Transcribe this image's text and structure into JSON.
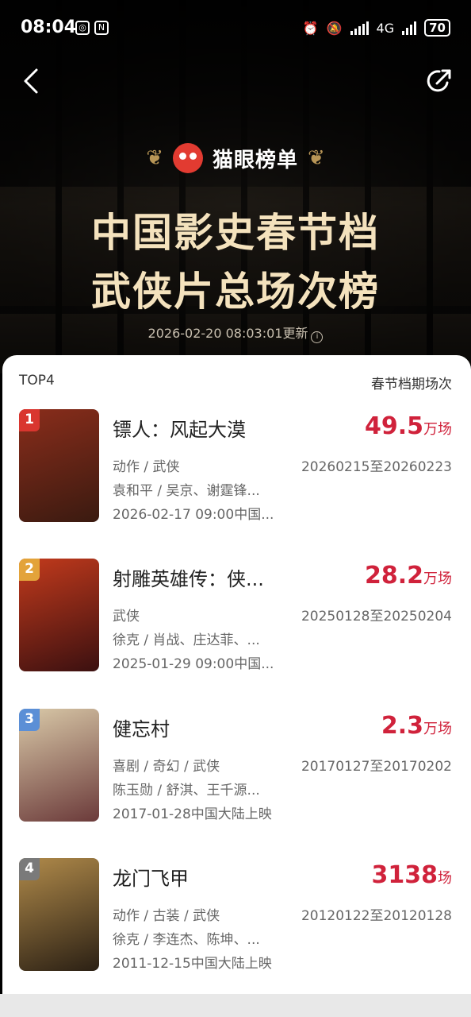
{
  "status_bar": {
    "time": "08:04",
    "network": "4G",
    "battery": "70"
  },
  "header": {
    "brand": "猫眼榜单",
    "title_line1": "中国影史春节档",
    "title_line2": "武侠片总场次榜",
    "update_time": "2026-02-20 08:03:01更新"
  },
  "list": {
    "top_label": "TOP4",
    "metric_label": "春节档期场次",
    "items": [
      {
        "rank": "1",
        "title": "镖人：风起大漠",
        "count": "49.5",
        "unit": "万场",
        "genre": "动作 / 武侠",
        "cast": "袁和平 / 吴京、谢霆锋...",
        "release": "2026-02-17 09:00中国...",
        "period": "20260215至20260223",
        "rank_color": "#d9362f",
        "poster_colors": [
          "#8a2d1b",
          "#3a1a10"
        ]
      },
      {
        "rank": "2",
        "title": "射雕英雄传：侠...",
        "count": "28.2",
        "unit": "万场",
        "genre": "武侠",
        "cast": "徐克 / 肖战、庄达菲、...",
        "release": "2025-01-29 09:00中国...",
        "period": "20250128至20250204",
        "rank_color": "#e3a33a",
        "poster_colors": [
          "#c23a1c",
          "#3b1010"
        ]
      },
      {
        "rank": "3",
        "title": "健忘村",
        "count": "2.3",
        "unit": "万场",
        "genre": "喜剧 / 奇幻 / 武侠",
        "cast": "陈玉勋 / 舒淇、王千源...",
        "release": "2017-01-28中国大陆上映",
        "period": "20170127至20170202",
        "rank_color": "#5b8fd6",
        "poster_colors": [
          "#d9c9a8",
          "#6b3a3a"
        ]
      },
      {
        "rank": "4",
        "title": "龙门飞甲",
        "count": "3138",
        "unit": "场",
        "genre": "动作 / 古装 / 武侠",
        "cast": "徐克 / 李连杰、陈坤、...",
        "release": "2011-12-15中国大陆上映",
        "period": "20120122至20120128",
        "rank_color": "#7a7a7a",
        "poster_colors": [
          "#b08a4a",
          "#2b2014"
        ]
      }
    ]
  },
  "colors": {
    "accent_red": "#d0223b",
    "title_gold": "#f4e2bd"
  }
}
